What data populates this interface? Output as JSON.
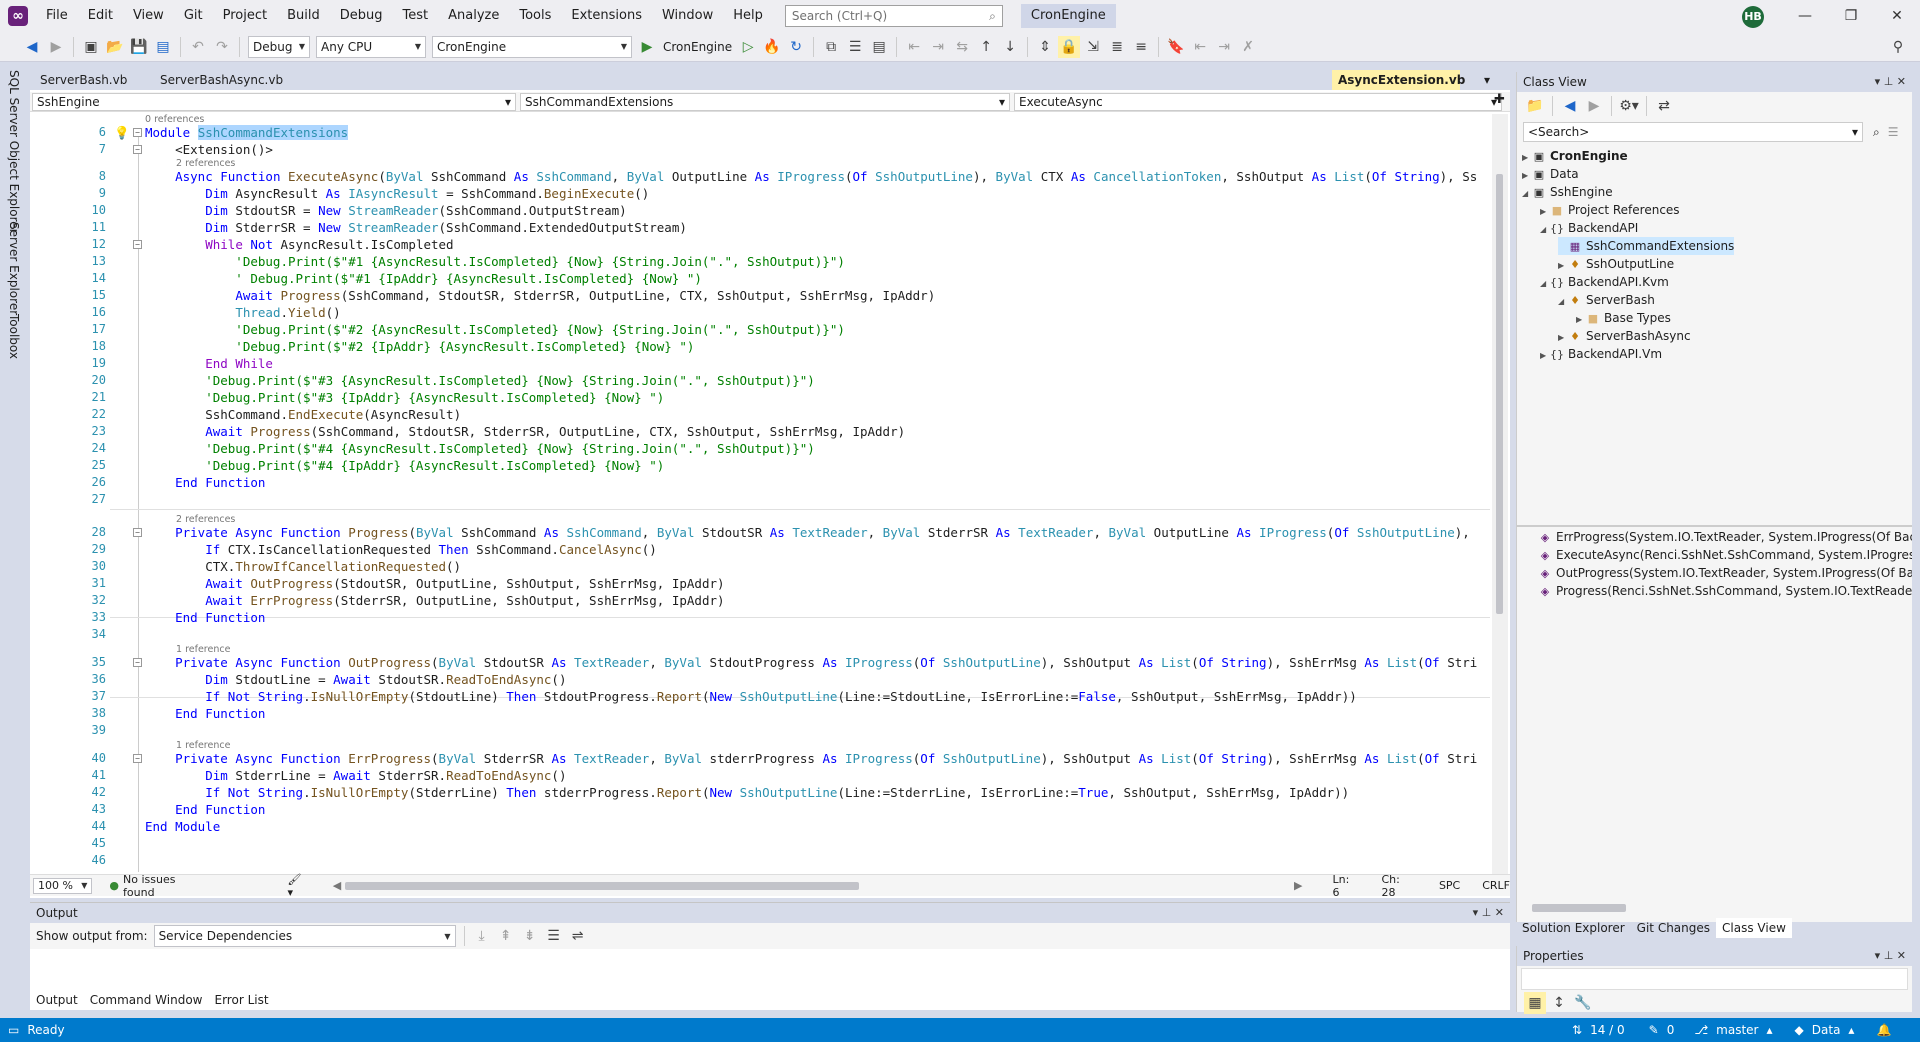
{
  "menu": {
    "items": [
      "File",
      "Edit",
      "View",
      "Git",
      "Project",
      "Build",
      "Debug",
      "Test",
      "Analyze",
      "Tools",
      "Extensions",
      "Window",
      "Help"
    ],
    "search_placeholder": "Search (Ctrl+Q)",
    "solution_name": "CronEngine",
    "avatar_initials": "HB"
  },
  "toolbar": {
    "config": "Debug",
    "platform": "Any CPU",
    "startup_project": "CronEngine",
    "run_label": "CronEngine"
  },
  "side_tabs": [
    "SQL Server Object Explorer",
    "Server Explorer",
    "Toolbox"
  ],
  "doc_tabs": {
    "inactive": [
      "ServerBash.vb",
      "ServerBashAsync.vb"
    ],
    "active": "AsyncExtension.vb"
  },
  "nav_bar": {
    "project": "SshEngine",
    "type": "SshCommandExtensions",
    "member": "ExecuteAsync"
  },
  "code": {
    "refs": {
      "r0": "0 references",
      "r8": "2 references",
      "r28": "2 references",
      "r35": "1 reference",
      "r40": "1 reference"
    }
  },
  "editor_status": {
    "zoom": "100 %",
    "issues": "No issues found",
    "line": "Ln: 6",
    "col": "Ch: 28",
    "spc": "SPC",
    "eol": "CRLF"
  },
  "output": {
    "title": "Output",
    "show_from_label": "Show output from:",
    "source": "Service Dependencies",
    "tabs": [
      "Output",
      "Command Window",
      "Error List"
    ]
  },
  "class_view": {
    "title": "Class View",
    "search": "<Search>",
    "tree": [
      {
        "label": "CronEngine",
        "bold": true
      },
      {
        "label": "Data"
      },
      {
        "label": "SshEngine"
      },
      {
        "label": "Project References"
      },
      {
        "label": "BackendAPI"
      },
      {
        "label": "SshCommandExtensions"
      },
      {
        "label": "SshOutputLine"
      },
      {
        "label": "BackendAPI.Kvm"
      },
      {
        "label": "ServerBash"
      },
      {
        "label": "Base Types"
      },
      {
        "label": "ServerBashAsync"
      },
      {
        "label": "BackendAPI.Vm"
      }
    ],
    "members": [
      "ErrProgress(System.IO.TextReader, System.IProgress(Of BackendAPI",
      "ExecuteAsync(Renci.SshNet.SshCommand, System.IProgress(Of Bac",
      "OutProgress(System.IO.TextReader, System.IProgress(Of BackendAP",
      "Progress(Renci.SshNet.SshCommand, System.IO.TextReader, Systen"
    ],
    "bottom_tabs": [
      "Solution Explorer",
      "Git Changes",
      "Class View"
    ]
  },
  "properties": {
    "title": "Properties"
  },
  "statusbar": {
    "ready": "Ready",
    "lines": "14 / 0",
    "edits": "0",
    "branch": "master",
    "repo": "Data"
  }
}
